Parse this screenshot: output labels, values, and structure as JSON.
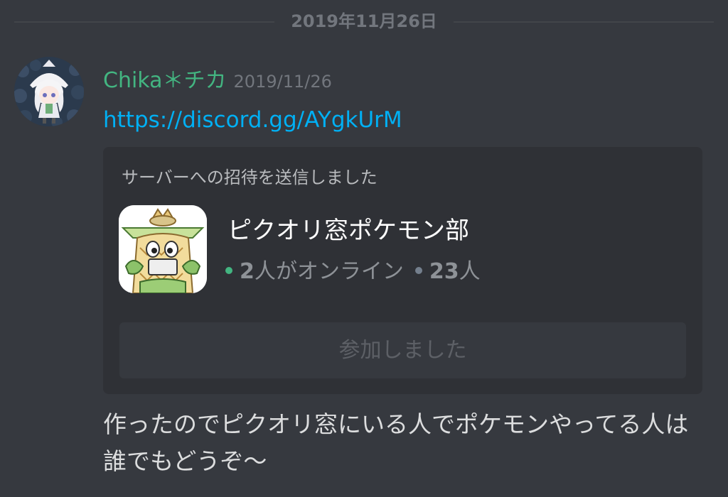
{
  "date_divider": "2019年11月26日",
  "message": {
    "author": "Chika＊チカ",
    "timestamp": "2019/11/26",
    "link": "https://discord.gg/AYgkUrM",
    "body": "作ったのでピクオリ窓にいる人でポケモンやってる人は誰でもどうぞ〜"
  },
  "invite": {
    "header": "サーバーへの招待を送信しました",
    "server_name": "ピクオリ窓ポケモン部",
    "online_count": "2",
    "online_label": "人がオンライン",
    "member_count": "23",
    "member_label": "人",
    "button_label": "参加しました"
  },
  "colors": {
    "background": "#36393f",
    "card": "#2f3136",
    "author_name": "#43b581",
    "link": "#00b0f4",
    "online_dot": "#43b581",
    "member_dot": "#747f8d"
  },
  "icons": {
    "avatar": "user-avatar-chibi-girl",
    "server": "server-icon-pineapple-duck"
  }
}
